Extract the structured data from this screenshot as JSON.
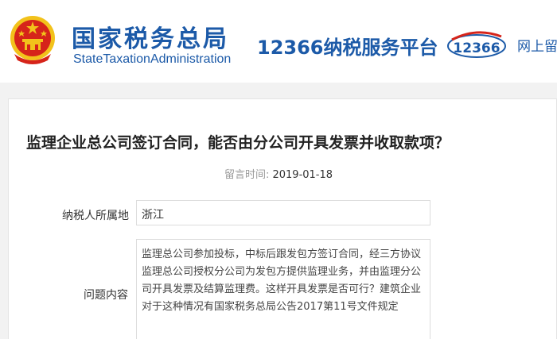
{
  "header": {
    "org_name_cn": "国家税务总局",
    "org_name_en": "StateTaxationAdministration",
    "service_title": "12366纳税服务平台",
    "service_logo_text": "12366",
    "online_link": "网上留"
  },
  "question": {
    "title": "监理企业总公司签订合同，能否由分公司开具发票并收取款项？",
    "date_label": "留言时间:",
    "date_value": "2019-01-18",
    "region_label": "纳税人所属地",
    "region_value": "浙江",
    "content_label": "问题内容",
    "content_value": "监理总公司参加投标，中标后跟发包方签订合同，经三方协议监理总公司授权分公司为发包方提供监理业务，并由监理分公司开具发票及结算监理费。这样开具发票是否可行？建筑企业对于这种情况有国家税务总局公告2017第11号文件规定"
  },
  "colors": {
    "brand_blue": "#1c5aa8",
    "emblem_red": "#d6241a",
    "emblem_gold": "#f2c21b"
  }
}
